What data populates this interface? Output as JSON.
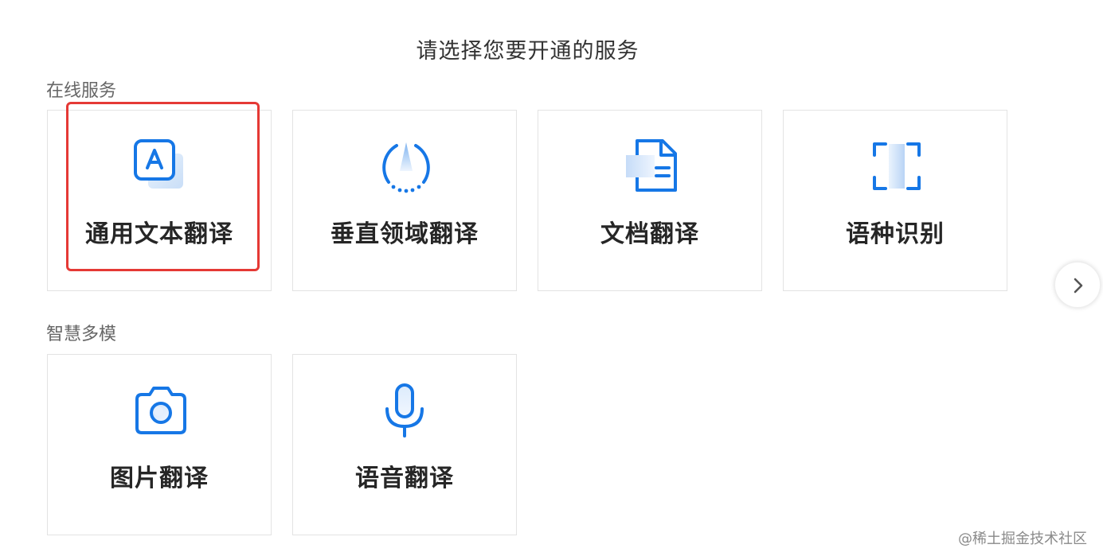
{
  "page_title": "请选择您要开通的服务",
  "sections": [
    {
      "title": "在线服务",
      "cards": [
        {
          "label": "通用文本翻译",
          "icon": "text-translate-icon"
        },
        {
          "label": "垂直领域翻译",
          "icon": "domain-translate-icon"
        },
        {
          "label": "文档翻译",
          "icon": "document-translate-icon"
        },
        {
          "label": "语种识别",
          "icon": "language-detect-icon"
        }
      ]
    },
    {
      "title": "智慧多模",
      "cards": [
        {
          "label": "图片翻译",
          "icon": "camera-icon"
        },
        {
          "label": "语音翻译",
          "icon": "microphone-icon"
        }
      ]
    }
  ],
  "next_button_icon": "chevron-right-icon",
  "selected_card": "通用文本翻译",
  "colors": {
    "accent": "#1677e6",
    "accent_light": "#cfe3fb",
    "highlight": "#e53935"
  },
  "watermark": "@稀土掘金技术社区"
}
